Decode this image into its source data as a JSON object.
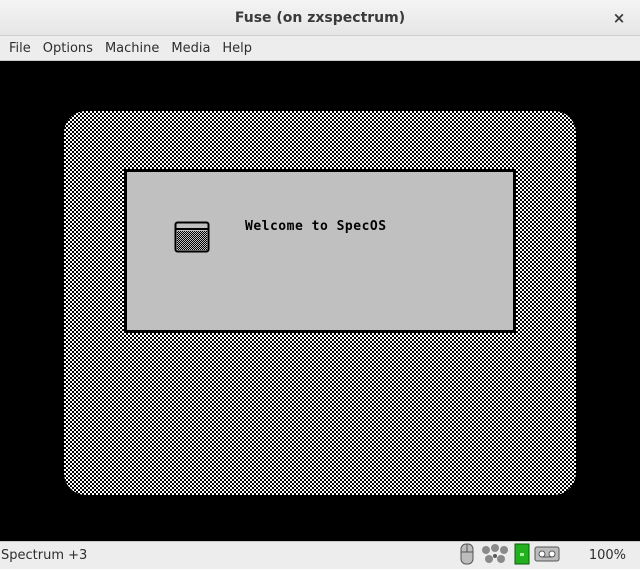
{
  "window": {
    "title": "Fuse (on zxspectrum)",
    "close_glyph": "×",
    "close_icon": "close-icon"
  },
  "menubar": {
    "items": [
      "File",
      "Options",
      "Machine",
      "Media",
      "Help"
    ]
  },
  "emulator": {
    "os_window": {
      "welcome_text": "Welcome to SpecOS",
      "icon": "window-icon"
    }
  },
  "statusbar": {
    "machine": "Spectrum +3",
    "icons": [
      "mouse-icon",
      "joystick-icon",
      "disk-led-icon",
      "tape-icon"
    ],
    "disk_led_color": "#22b01e",
    "zoom": "100%"
  }
}
